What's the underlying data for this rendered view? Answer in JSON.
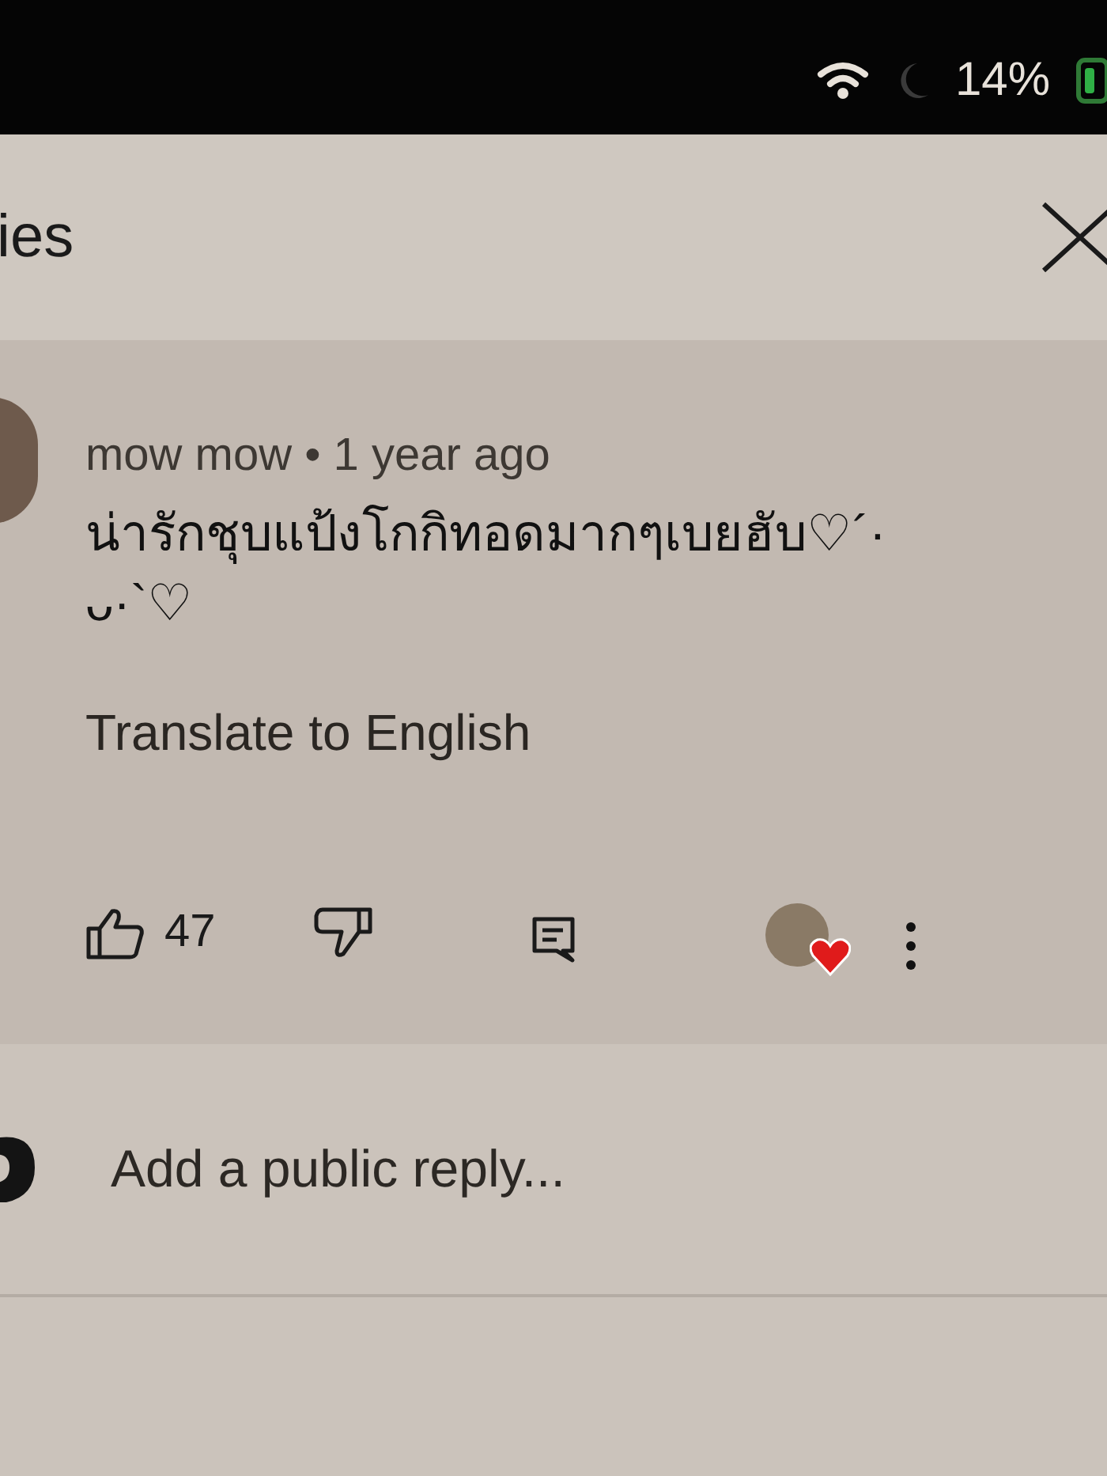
{
  "status_bar": {
    "battery": "14%"
  },
  "header": {
    "title": "ies"
  },
  "comment": {
    "meta": "mow mow • 1 year ago",
    "text": "น่ารักชุบแป้งโกกิทอดมากๆเบยฮับ♡´·\nᴗ·`♡",
    "translate": "Translate to English",
    "likes": "47",
    "creator_hearted": true
  },
  "reply": {
    "placeholder": "Add a public reply..."
  }
}
